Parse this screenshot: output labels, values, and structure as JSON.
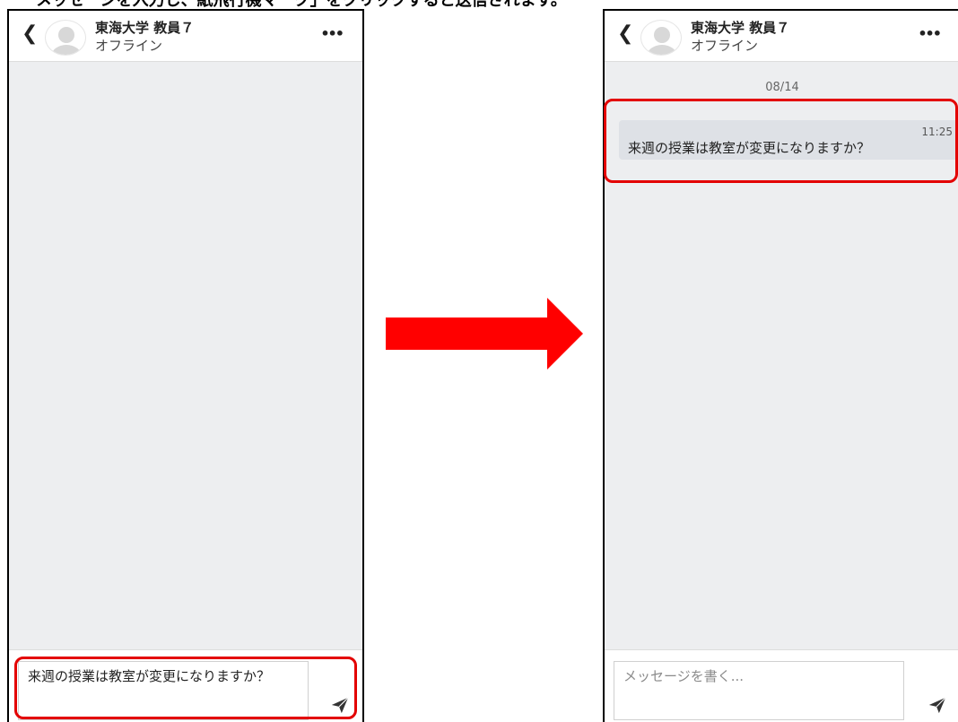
{
  "caption": "メッセージを入力し、紙飛行機マーク」をクリックすると送信されます。",
  "left_panel": {
    "header": {
      "contact_name": "東海大学 教員７",
      "status": "オフライン"
    },
    "compose": {
      "value": "来週の授業は教室が変更になりますか？"
    }
  },
  "right_panel": {
    "header": {
      "contact_name": "東海大学 教員７",
      "status": "オフライン"
    },
    "date_separator": "08/14",
    "messages": [
      {
        "time": "11:25",
        "text": "来週の授業は教室が変更になりますか？"
      }
    ],
    "compose": {
      "placeholder": "メッセージを書く..."
    }
  },
  "colors": {
    "highlight": "#e30000",
    "arrow": "#ff0000",
    "chat_background": "#edeef0",
    "bubble": "#dee1e6"
  },
  "icons": {
    "back": "chevron-left-icon",
    "more": "ellipsis-icon",
    "send": "paper-plane-icon",
    "avatar": "user-avatar-icon"
  }
}
